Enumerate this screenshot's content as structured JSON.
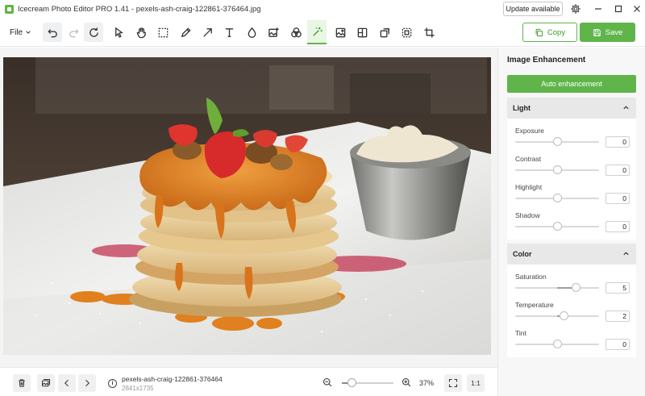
{
  "window": {
    "title": "Icecream Photo Editor PRO 1.41 - pexels-ash-craig-122861-376464.jpg",
    "update_label": "Update available"
  },
  "toolbar": {
    "file_label": "File",
    "copy_label": "Copy",
    "save_label": "Save",
    "active_tool": "auto-enhance"
  },
  "panel": {
    "title": "Image Enhancement",
    "auto_label": "Auto enhancement",
    "sections": [
      {
        "label": "Light",
        "sliders": [
          {
            "label": "Exposure",
            "value": "0",
            "level": 0.5
          },
          {
            "label": "Contrast",
            "value": "0",
            "level": 0.5
          },
          {
            "label": "Highlight",
            "value": "0",
            "level": 0.5
          },
          {
            "label": "Shadow",
            "value": "0",
            "level": 0.5
          }
        ]
      },
      {
        "label": "Color",
        "sliders": [
          {
            "label": "Saturation",
            "value": "5",
            "level": 0.73
          },
          {
            "label": "Temperature",
            "value": "2",
            "level": 0.58
          },
          {
            "label": "Tint",
            "value": "0",
            "level": 0.5
          }
        ]
      }
    ]
  },
  "bottom": {
    "file_name": "pexels-ash-craig-122861-376464",
    "dimensions": "2841x1735",
    "zoom_label": "37%",
    "zoom_level": 0.2,
    "one_to_one_label": "1:1"
  },
  "colors": {
    "accent": "#5fb54a",
    "panel_bg": "#f7f7f7",
    "section_header": "#e8e8e8"
  }
}
